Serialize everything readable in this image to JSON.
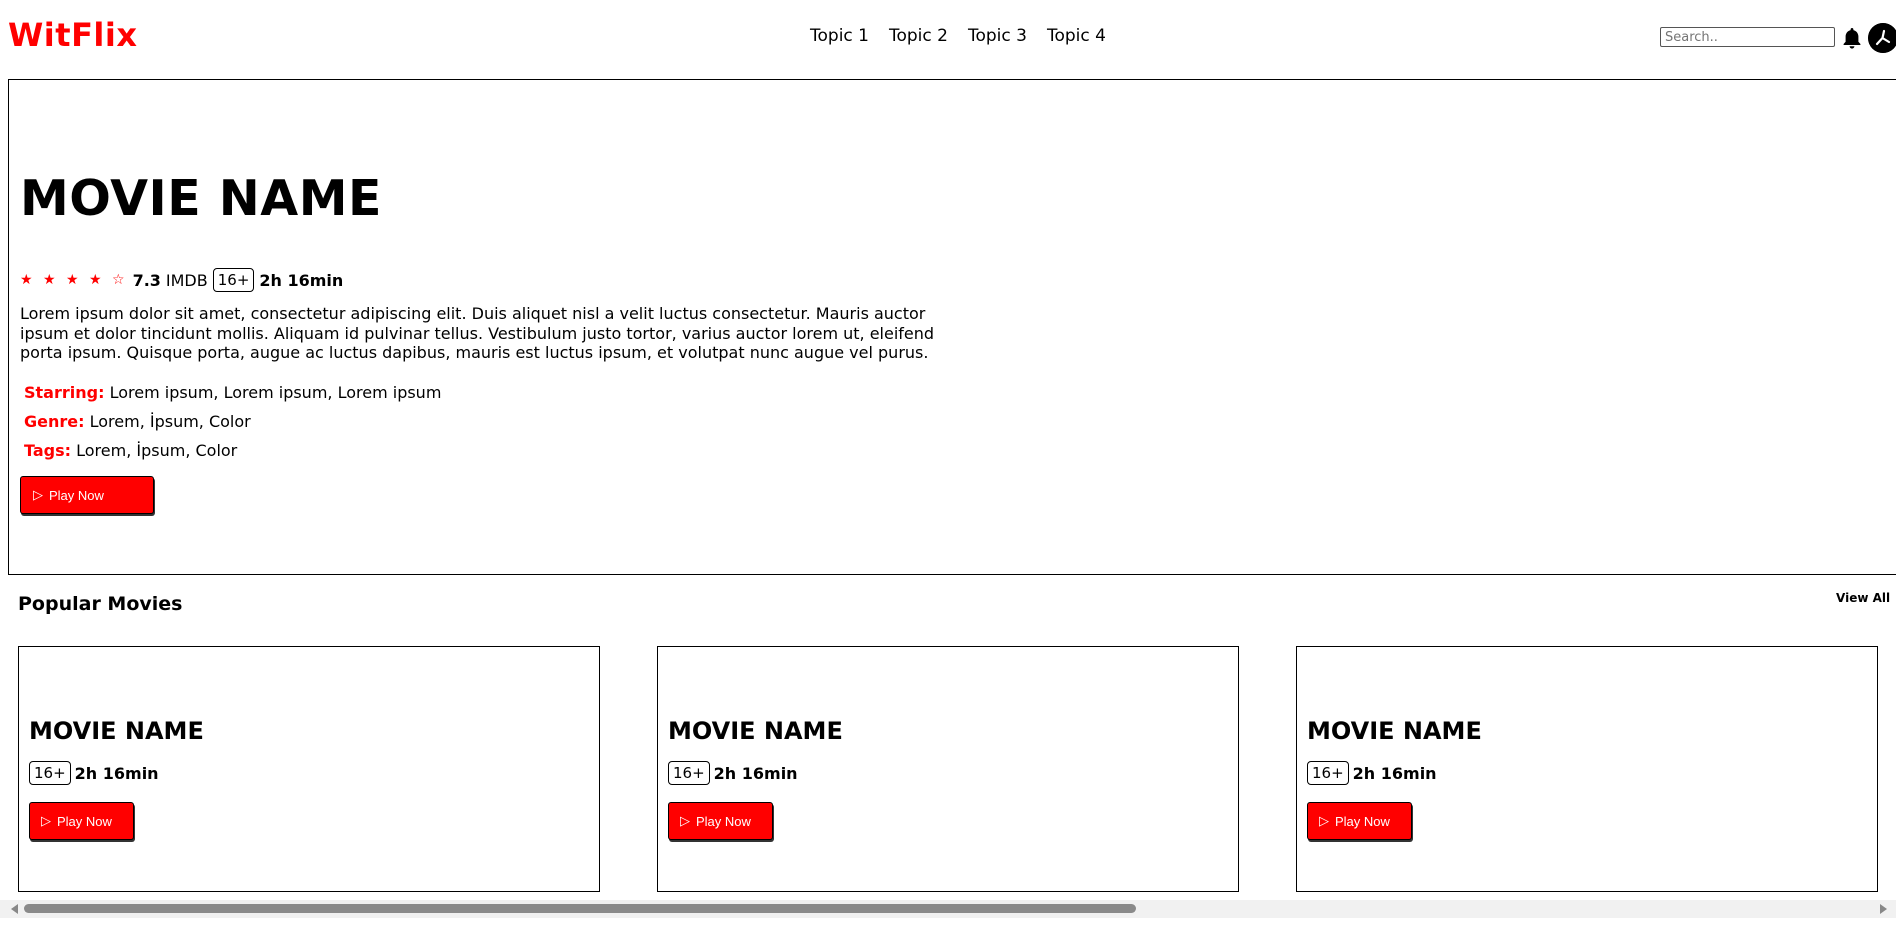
{
  "header": {
    "logo": "WitFlix",
    "nav": [
      "Topic 1",
      "Topic 2",
      "Topic 3",
      "Topic 4"
    ],
    "search_placeholder": "Search.."
  },
  "hero": {
    "title": "MOVIE NAME",
    "stars": "★ ★ ★ ★ ☆",
    "rating": "7.3",
    "rating_source": "IMDB",
    "age": "16+",
    "duration": "2h 16min",
    "description": "Lorem ipsum dolor sit amet, consectetur adipiscing elit. Duis aliquet nisl a velit luctus consectetur. Mauris auctor ipsum et dolor tincidunt mollis. Aliquam id pulvinar tellus. Vestibulum justo tortor, varius auctor lorem ut, eleifend porta ipsum. Quisque porta, augue ac luctus dapibus, mauris est luctus ipsum, et volutpat nunc augue vel purus.",
    "starring_label": "Starring:",
    "starring_value": "Lorem ipsum, Lorem ipsum, Lorem ipsum",
    "genre_label": "Genre:",
    "genre_value": "Lorem, İpsum, Color",
    "tags_label": "Tags:",
    "tags_value": "Lorem, İpsum, Color",
    "play_label": "Play Now"
  },
  "popular": {
    "title": "Popular Movies",
    "view_all": "View All",
    "cards": [
      {
        "title": "MOVIE NAME",
        "age": "16+",
        "duration": "2h 16min",
        "play_label": "Play Now"
      },
      {
        "title": "MOVIE NAME",
        "age": "16+",
        "duration": "2h 16min",
        "play_label": "Play Now"
      },
      {
        "title": "MOVIE NAME",
        "age": "16+",
        "duration": "2h 16min",
        "play_label": "Play Now"
      }
    ]
  },
  "colors": {
    "brand": "#ff0000",
    "text": "#000000",
    "background": "#ffffff"
  },
  "icons": {
    "bell": "bell-icon",
    "avatar": "avatar",
    "play": "play-icon"
  }
}
